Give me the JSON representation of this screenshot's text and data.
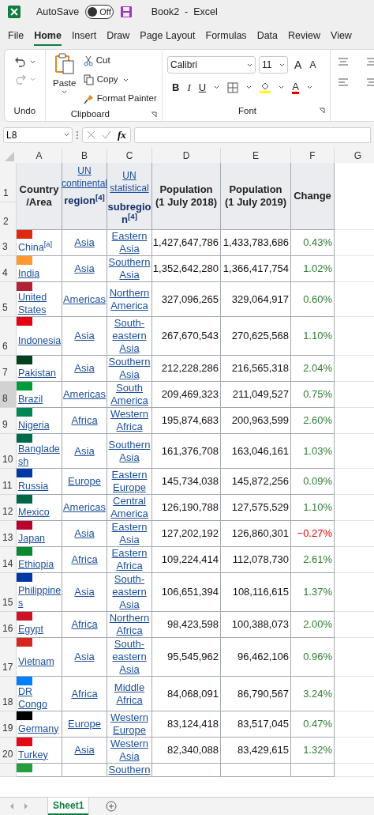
{
  "title_bar": {
    "autosave": "AutoSave",
    "autosave_on": false,
    "toggle_label": "Off",
    "title": "Book2  -  Excel"
  },
  "menu_tabs": [
    {
      "label": "File",
      "selected": false
    },
    {
      "label": "Home",
      "selected": true
    },
    {
      "label": "Insert",
      "selected": false
    },
    {
      "label": "Draw",
      "selected": false
    },
    {
      "label": "Page Layout",
      "selected": false
    },
    {
      "label": "Formulas",
      "selected": false
    },
    {
      "label": "Data",
      "selected": false
    },
    {
      "label": "Review",
      "selected": false
    },
    {
      "label": "View",
      "selected": false
    }
  ],
  "ribbon": {
    "undo_label": "Undo",
    "paste": "Paste",
    "cut": "Cut",
    "copy": "Copy",
    "format_painter": "Format Painter",
    "clipboard_label": "Clipboard",
    "font_name": "Calibri",
    "font_size": "11",
    "grow": "A",
    "shrink": "A",
    "bold": "B",
    "italic": "I",
    "underline": "U",
    "font_color": "A",
    "font_label": "Font"
  },
  "formula_bar": {
    "name_box": "L8",
    "fx": "fx"
  },
  "columns": [
    "A",
    "B",
    "C",
    "D",
    "E",
    "F",
    "G"
  ],
  "header": {
    "row_numbers": [
      "1",
      "2"
    ],
    "country": "Country /Area",
    "continent_link": "UN continental",
    "continent": "region$^{[4]}$",
    "subregion_link": "UN statistical",
    "subregion": "subregion$^{[4]}$",
    "pop2018_title": "Population",
    "pop2018_date": "(1 July 2018)",
    "pop2019_title": "Population",
    "pop2019_date": "(1 July 2019)",
    "change": "Change"
  },
  "rows": [
    {
      "n": "3",
      "selected": false,
      "color": "#de2910",
      "country": "China$^{[a]}$",
      "underlined": false,
      "continent": "Asia",
      "subregion": "Eastern Asia",
      "pop2018": "1,427,647,786",
      "pop2019": "1,433,783,686",
      "change": "0.43%",
      "negative": false
    },
    {
      "n": "4",
      "selected": false,
      "color": "#ff9933",
      "country": "India",
      "underlined": true,
      "continent": "Asia",
      "subregion": "Southern Asia",
      "pop2018": "1,352,642,280",
      "pop2019": "1,366,417,754",
      "change": "1.02%",
      "negative": false
    },
    {
      "n": "5",
      "selected": false,
      "color": "#b22234",
      "country": "United States",
      "underlined": true,
      "continent": "Americas",
      "subregion": "Northern America",
      "pop2018": "327,096,265",
      "pop2019": "329,064,917",
      "change": "0.60%",
      "negative": false
    },
    {
      "n": "6",
      "selected": false,
      "color": "#e70011",
      "country": "Indonesia",
      "underlined": true,
      "continent": "Asia",
      "subregion": "South-eastern Asia",
      "pop2018": "267,670,543",
      "pop2019": "270,625,568",
      "change": "1.10%",
      "negative": false
    },
    {
      "n": "7",
      "selected": false,
      "color": "#01411c",
      "country": "Pakistan",
      "underlined": true,
      "continent": "Asia",
      "subregion": "Southern Asia",
      "pop2018": "212,228,286",
      "pop2019": "216,565,318",
      "change": "2.04%",
      "negative": false
    },
    {
      "n": "8",
      "selected": true,
      "color": "#009c3b",
      "country": "Brazil",
      "underlined": true,
      "continent": "Americas",
      "subregion": "South America",
      "pop2018": "209,469,323",
      "pop2019": "211,049,527",
      "change": "0.75%",
      "negative": false
    },
    {
      "n": "9",
      "selected": false,
      "color": "#008751",
      "country": "Nigeria",
      "underlined": true,
      "continent": "Africa",
      "subregion": "Western Africa",
      "pop2018": "195,874,683",
      "pop2019": "200,963,599",
      "change": "2.60%",
      "negative": false
    },
    {
      "n": "10",
      "selected": false,
      "color": "#006a4e",
      "country": "Bangladesh",
      "underlined": true,
      "continent": "Asia",
      "subregion": "Southern Asia",
      "pop2018": "161,376,708",
      "pop2019": "163,046,161",
      "change": "1.03%",
      "negative": false
    },
    {
      "n": "11",
      "selected": false,
      "color": "#0039a6",
      "country": "Russia",
      "underlined": true,
      "continent": "Europe",
      "subregion": "Eastern Europe",
      "pop2018": "145,734,038",
      "pop2019": "145,872,256",
      "change": "0.09%",
      "negative": false
    },
    {
      "n": "12",
      "selected": false,
      "color": "#006847",
      "country": "Mexico",
      "underlined": true,
      "continent": "Americas",
      "subregion": "Central America",
      "pop2018": "126,190,788",
      "pop2019": "127,575,529",
      "change": "1.10%",
      "negative": false
    },
    {
      "n": "13",
      "selected": false,
      "color": "#bc002d",
      "country": "Japan",
      "underlined": true,
      "continent": "Asia",
      "subregion": "Eastern Asia",
      "pop2018": "127,202,192",
      "pop2019": "126,860,301",
      "change": "−0.27%",
      "negative": true
    },
    {
      "n": "14",
      "selected": false,
      "color": "#078930",
      "country": "Ethiopia",
      "underlined": true,
      "continent": "Africa",
      "subregion": "Eastern Africa",
      "pop2018": "109,224,414",
      "pop2019": "112,078,730",
      "change": "2.61%",
      "negative": false
    },
    {
      "n": "15",
      "selected": false,
      "color": "#0038a8",
      "country": "Philippines",
      "underlined": true,
      "continent": "Asia",
      "subregion": "South-eastern Asia",
      "pop2018": "106,651,394",
      "pop2019": "108,116,615",
      "change": "1.37%",
      "negative": false
    },
    {
      "n": "16",
      "selected": false,
      "color": "#ce1126",
      "country": "Egypt",
      "underlined": true,
      "continent": "Africa",
      "subregion": "Northern Africa",
      "pop2018": "98,423,598",
      "pop2019": "100,388,073",
      "change": "2.00%",
      "negative": false
    },
    {
      "n": "17",
      "selected": false,
      "color": "#da251d",
      "country": "Vietnam",
      "underlined": true,
      "continent": "Asia",
      "subregion": "South-eastern Asia",
      "pop2018": "95,545,962",
      "pop2019": "96,462,106",
      "change": "0.96%",
      "negative": false
    },
    {
      "n": "18",
      "selected": false,
      "color": "#007fff",
      "country": "DR Congo",
      "underlined": true,
      "continent": "Africa",
      "subregion": "Middle Africa",
      "pop2018": "84,068,091",
      "pop2019": "86,790,567",
      "change": "3.24%",
      "negative": false
    },
    {
      "n": "19",
      "selected": false,
      "color": "#000000",
      "country": "Germany",
      "underlined": true,
      "continent": "Europe",
      "subregion": "Western Europe",
      "pop2018": "83,124,418",
      "pop2019": "83,517,045",
      "change": "0.47%",
      "negative": false
    },
    {
      "n": "20",
      "selected": false,
      "color": "#e30a17",
      "country": "Turkey",
      "underlined": true,
      "continent": "Asia",
      "subregion": "Western Asia",
      "pop2018": "82,340,088",
      "pop2019": "83,429,615",
      "change": "1.32%",
      "negative": false
    },
    {
      "color": "#239f40",
      "subregion": "Southern"
    }
  ],
  "sheet_tabs": [
    {
      "label": "Sheet1",
      "selected": true
    }
  ]
}
